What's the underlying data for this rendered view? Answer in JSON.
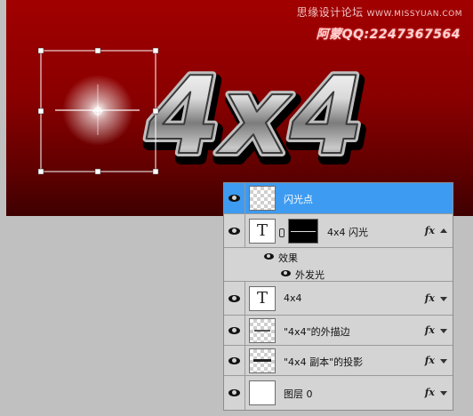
{
  "watermark": {
    "site": "思缘设计论坛",
    "url": "WWW.MISSYUAN.COM",
    "author": "阿蒙QQ:2247367564"
  },
  "artwork": {
    "text": "4x4"
  },
  "layers": [
    {
      "name": "闪光点",
      "selected": true,
      "type": "pixel",
      "has_fx": false
    },
    {
      "name": "4x4 闪光",
      "selected": false,
      "type": "text-with-mask",
      "has_fx": true
    },
    {
      "name": "4x4",
      "selected": false,
      "type": "text",
      "has_fx": true
    },
    {
      "name": "\"4x4\"的外描边",
      "selected": false,
      "type": "pixel",
      "has_fx": true
    },
    {
      "name": "\"4x4 副本\"的投影",
      "selected": false,
      "type": "pixel",
      "has_fx": true
    },
    {
      "name": "图层 0",
      "selected": false,
      "type": "white",
      "has_fx": true
    }
  ],
  "effects": {
    "header": "效果",
    "items": [
      "外发光"
    ]
  },
  "thumb_text": "T",
  "fx_label": "fx",
  "colors": {
    "selection": "#3d9bf2",
    "canvas_top": "#a10000",
    "canvas_bottom": "#3e0000",
    "panel_bg": "#d4d4d4"
  }
}
